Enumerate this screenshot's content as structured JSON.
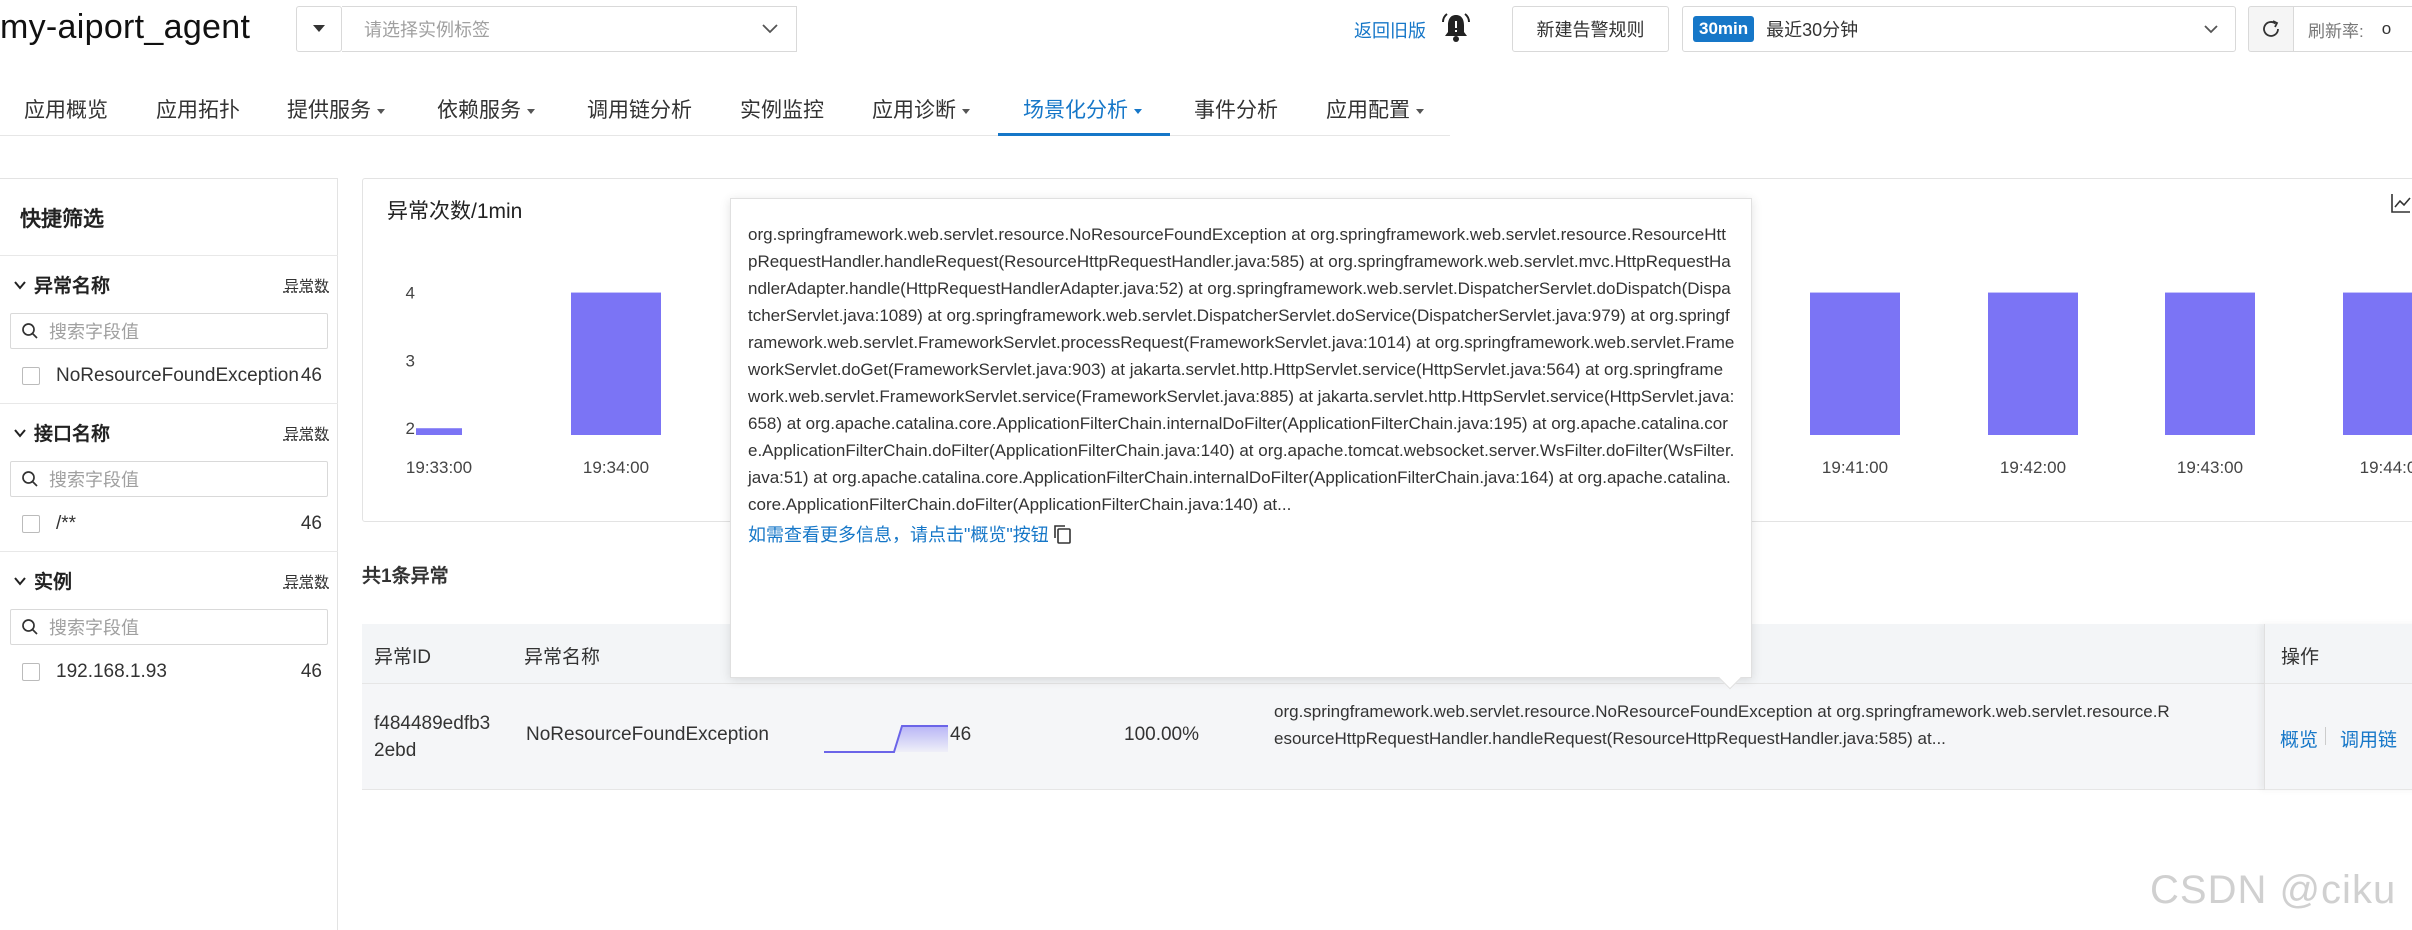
{
  "header": {
    "app_title": "my-aiport_agent",
    "tag_placeholder": "请选择实例标签",
    "old_version": "返回旧版",
    "new_alert": "新建告警规则",
    "time_badge": "30min",
    "time_label": "最近30分钟",
    "refresh_rate_label": "刷新率:",
    "refresh_rate_value": "o"
  },
  "nav": {
    "tabs": [
      {
        "label": "应用概览",
        "caret": false
      },
      {
        "label": "应用拓扑",
        "caret": false
      },
      {
        "label": "提供服务",
        "caret": true
      },
      {
        "label": "依赖服务",
        "caret": true
      },
      {
        "label": "调用链分析",
        "caret": false
      },
      {
        "label": "实例监控",
        "caret": false
      },
      {
        "label": "应用诊断",
        "caret": true
      },
      {
        "label": "场景化分析",
        "caret": true,
        "active": true
      },
      {
        "label": "事件分析",
        "caret": false
      },
      {
        "label": "应用配置",
        "caret": true
      }
    ]
  },
  "sidebar": {
    "title": "快捷筛选",
    "count_label": "异常数",
    "search_placeholder": "搜索字段值",
    "groups": [
      {
        "title": "异常名称",
        "items": [
          {
            "label": "NoResourceFoundException",
            "count": "46"
          }
        ]
      },
      {
        "title": "接口名称",
        "items": [
          {
            "label": "/**",
            "count": "46"
          }
        ]
      },
      {
        "title": "实例",
        "items": [
          {
            "label": "192.168.1.93",
            "count": "46"
          }
        ]
      }
    ]
  },
  "chart_data": {
    "type": "bar",
    "title": "异常次数/1min",
    "categories": [
      "19:33:00",
      "19:34:00",
      "19:41:00",
      "19:42:00",
      "19:43:00",
      "19:44:0"
    ],
    "values": [
      2,
      4,
      4,
      4,
      4,
      4
    ],
    "ylim": [
      1.9,
      4.2
    ],
    "yticks": [
      "2",
      "3",
      "4"
    ],
    "color": "#7b74f5"
  },
  "list": {
    "total": "共1条异常",
    "headers": {
      "id": "异常ID",
      "name": "异常名称",
      "ops": "操作"
    },
    "row": {
      "id": "f484489edfb32ebd",
      "name": "NoResourceFoundException",
      "count": "46",
      "percent": "100.00%",
      "stack": "org.springframework.web.servlet.resource.NoResourceFoundException at org.springframework.web.servlet.resource.ResourceHttpRequestHandler.handleRequest(ResourceHttpRequestHandler.java:585) at...",
      "op_overview": "概览",
      "op_trace": "调用链"
    }
  },
  "tooltip": {
    "stack": "org.springframework.web.servlet.resource.NoResourceFoundException at org.springframework.web.servlet.resource.ResourceHttpRequestHandler.handleRequest(ResourceHttpRequestHandler.java:585) at org.springframework.web.servlet.mvc.HttpRequestHandlerAdapter.handle(HttpRequestHandlerAdapter.java:52) at org.springframework.web.servlet.DispatcherServlet.doDispatch(DispatcherServlet.java:1089) at org.springframework.web.servlet.DispatcherServlet.doService(DispatcherServlet.java:979) at org.springframework.web.servlet.FrameworkServlet.processRequest(FrameworkServlet.java:1014) at org.springframework.web.servlet.FrameworkServlet.doGet(FrameworkServlet.java:903) at jakarta.servlet.http.HttpServlet.service(HttpServlet.java:564) at org.springframework.web.servlet.FrameworkServlet.service(FrameworkServlet.java:885) at jakarta.servlet.http.HttpServlet.service(HttpServlet.java:658) at org.apache.catalina.core.ApplicationFilterChain.internalDoFilter(ApplicationFilterChain.java:195) at org.apache.catalina.core.ApplicationFilterChain.doFilter(ApplicationFilterChain.java:140) at org.apache.tomcat.websocket.server.WsFilter.doFilter(WsFilter.java:51) at org.apache.catalina.core.ApplicationFilterChain.internalDoFilter(ApplicationFilterChain.java:164) at org.apache.catalina.core.ApplicationFilterChain.doFilter(ApplicationFilterChain.java:140) at...",
    "hint": "如需查看更多信息，请点击\"概览\"按钮"
  },
  "watermark": "CSDN @ciku"
}
